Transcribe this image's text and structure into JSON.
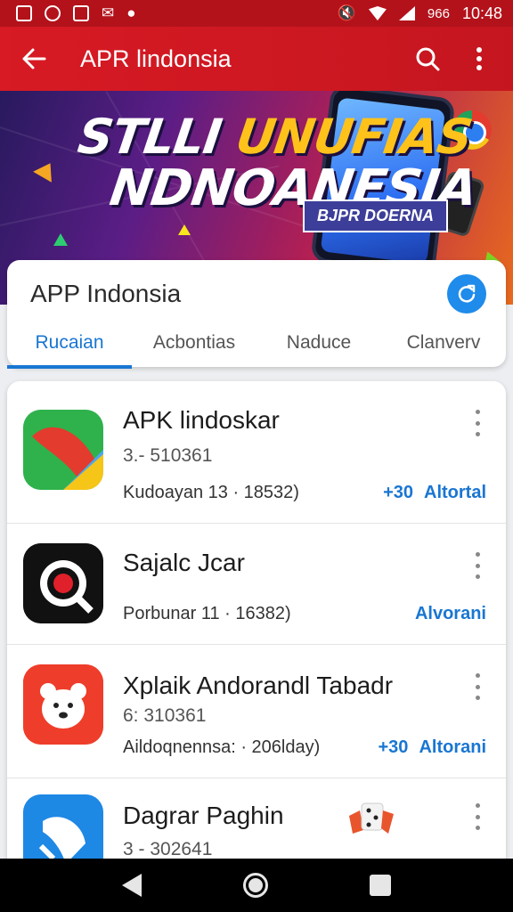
{
  "status_bar": {
    "battery_text": "966",
    "time": "10:48"
  },
  "app_bar": {
    "title": "APR lindonsia"
  },
  "banner": {
    "headline_line1_a": "STLLI ",
    "headline_line1_b": "UNUFIAS",
    "headline_line2": "NDNOANESIA",
    "tag": "BJPR DOERNA"
  },
  "card": {
    "title": "APP Indonsia",
    "tabs": [
      {
        "label": "Rucaian",
        "active": true
      },
      {
        "label": "Acbontias",
        "active": false
      },
      {
        "label": "Naduce",
        "active": false
      },
      {
        "label": "Clanverv",
        "active": false
      }
    ]
  },
  "apps": [
    {
      "name": "APK lindoskar",
      "id": "3.- 510361",
      "meta": "Kudoayan 13 · 18532)",
      "count": "+30",
      "action": "Altortal",
      "icon": "chrome-like-icon"
    },
    {
      "name": "Sajalc Jcar",
      "id": "",
      "meta": "Porbunar 11 · 16382)",
      "count": "",
      "action": "Alvorani",
      "icon": "target-icon"
    },
    {
      "name": "Xplaik Andorandl Tabadr",
      "id": "6: 310361",
      "meta": "Aildoqnennsa: · 206lday)",
      "count": "+30",
      "action": "Altorani",
      "icon": "bear-icon"
    },
    {
      "name": "Dagrar Paghin",
      "id": "3 - 302641",
      "meta": "",
      "count": "",
      "action": "",
      "icon": "play-icon"
    }
  ],
  "colors": {
    "primary_red": "#d71a24",
    "accent_blue": "#1976d2"
  }
}
